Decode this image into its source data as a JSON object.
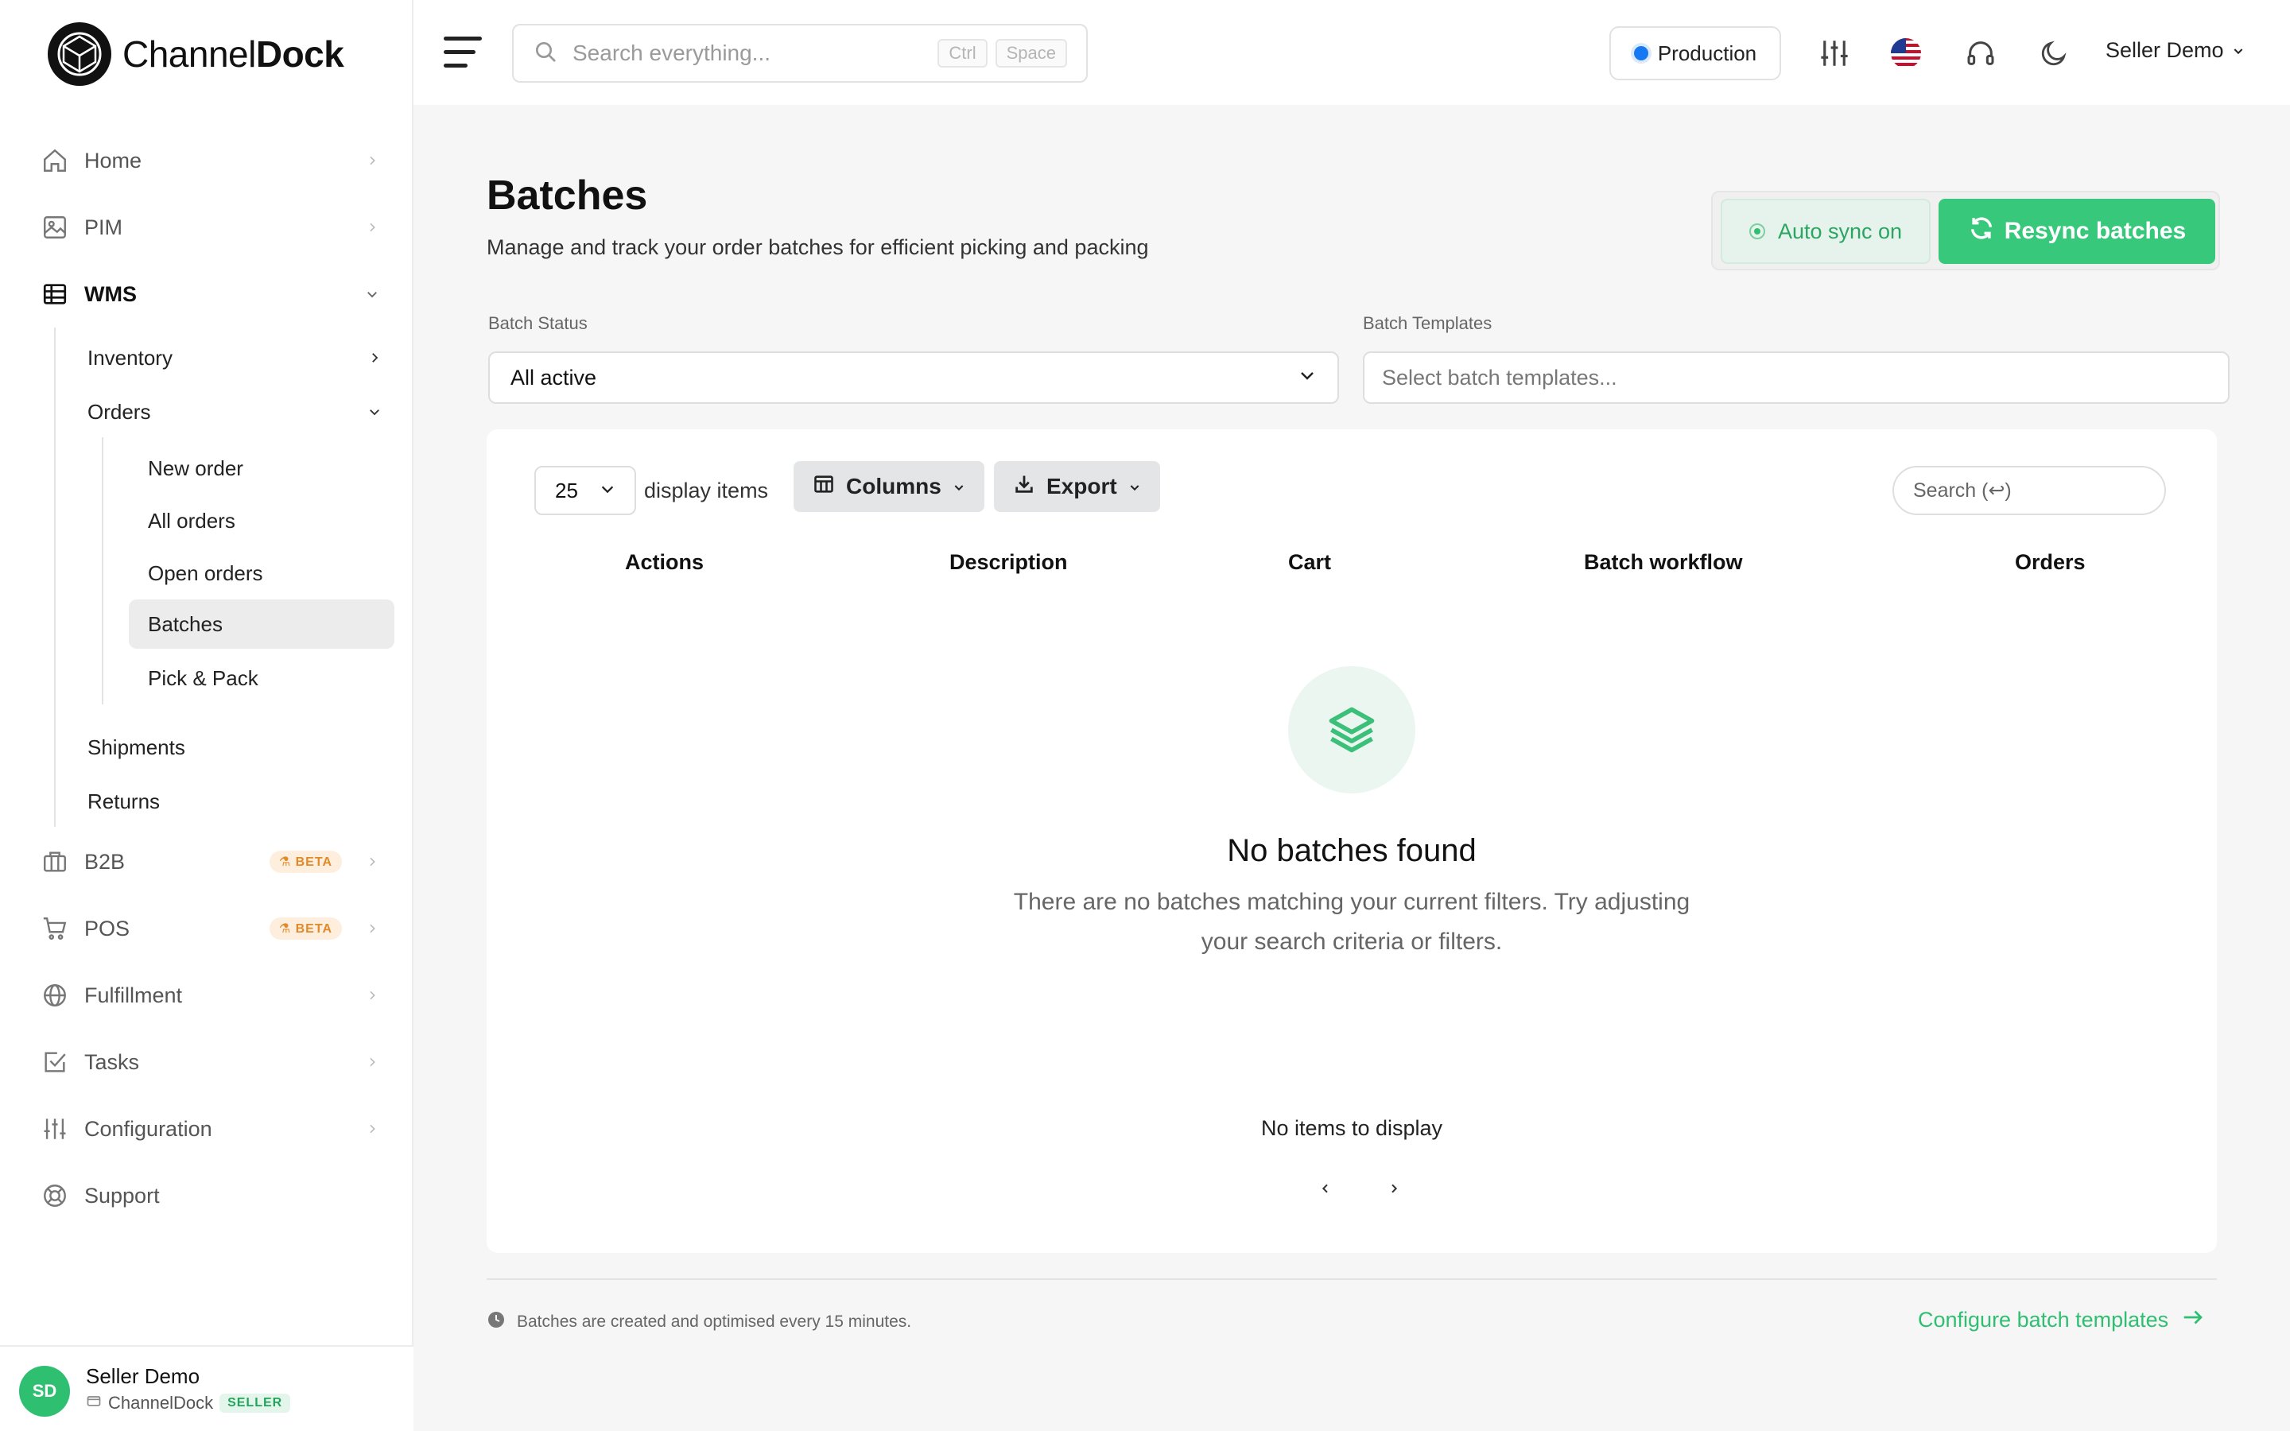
{
  "brand": {
    "name_light": "Channel",
    "name_bold": "Dock"
  },
  "search": {
    "placeholder": "Search everything...",
    "kbd1": "Ctrl",
    "kbd2": "Space"
  },
  "environment": {
    "label": "Production",
    "dot_color": "#1877f2"
  },
  "top_user": {
    "name": "Seller Demo"
  },
  "sidebar": {
    "items": [
      {
        "label": "Home",
        "icon": "home-icon"
      },
      {
        "label": "PIM",
        "icon": "image-icon"
      },
      {
        "label": "WMS",
        "icon": "table-icon"
      },
      {
        "label": "B2B",
        "icon": "briefcase-icon",
        "badge": "BETA"
      },
      {
        "label": "POS",
        "icon": "cart-icon",
        "badge": "BETA"
      },
      {
        "label": "Fulfillment",
        "icon": "globe-icon"
      },
      {
        "label": "Tasks",
        "icon": "checkbox-icon"
      },
      {
        "label": "Configuration",
        "icon": "sliders-icon"
      },
      {
        "label": "Support",
        "icon": "lifebuoy-icon"
      }
    ],
    "wms_children": {
      "inventory": "Inventory",
      "orders": "Orders",
      "shipments": "Shipments",
      "returns": "Returns"
    },
    "orders_children": [
      "New order",
      "All orders",
      "Open orders",
      "Batches",
      "Pick & Pack"
    ],
    "active": "Batches"
  },
  "user": {
    "initials": "SD",
    "name": "Seller Demo",
    "org": "ChannelDock",
    "role": "SELLER"
  },
  "page": {
    "title": "Batches",
    "subtitle": "Manage and track your order batches for efficient picking and packing",
    "auto_sync_label": "Auto sync on",
    "resync_label": "Resync batches"
  },
  "filters": {
    "status_label": "Batch Status",
    "status_value": "All active",
    "templates_label": "Batch Templates",
    "templates_placeholder": "Select batch templates..."
  },
  "table": {
    "page_size": "25",
    "display_items_label": "display items",
    "columns_label": "Columns",
    "export_label": "Export",
    "search_placeholder": "Search (↩)",
    "headers": [
      "Actions",
      "Description",
      "Cart",
      "Batch workflow",
      "Orders"
    ],
    "empty_title": "No batches found",
    "empty_desc": "There are no batches matching your current filters. Try adjusting your search criteria or filters.",
    "no_items": "No items to display"
  },
  "footer": {
    "note": "Batches are created and optimised every 15 minutes.",
    "link": "Configure batch templates"
  },
  "colors": {
    "accent": "#38c87c",
    "accent_text": "#2fbf71",
    "beta": "#e08a2a"
  }
}
